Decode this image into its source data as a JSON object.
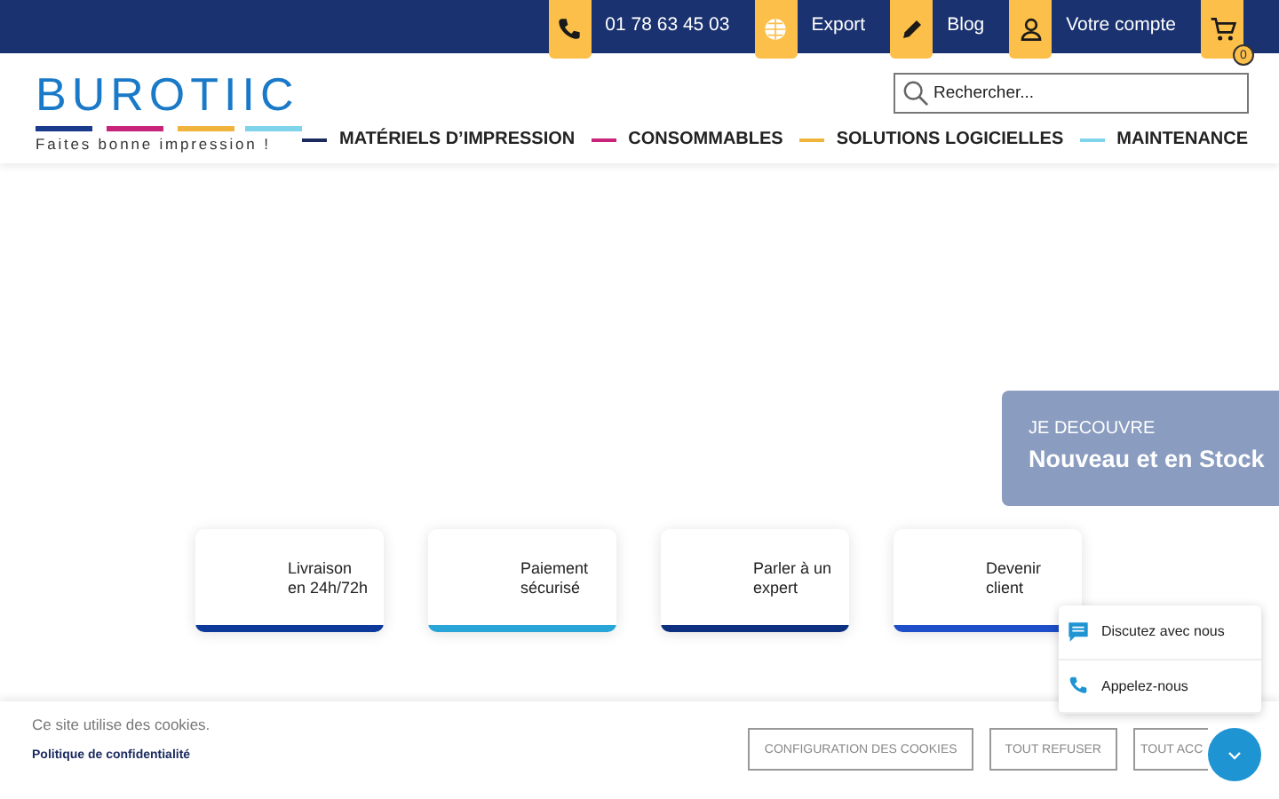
{
  "top_bar": {
    "items": [
      {
        "kind": "phone",
        "label": "01 78 63 45 03"
      },
      {
        "kind": "globe",
        "label": "Export"
      },
      {
        "kind": "pencil",
        "label": "Blog"
      },
      {
        "kind": "user",
        "label": "Votre compte"
      },
      {
        "kind": "cart",
        "badge": "0"
      }
    ]
  },
  "logo": {
    "name": "BUROTIIC",
    "tagline": "Faites bonne impression !"
  },
  "search": {
    "placeholder": "Rechercher..."
  },
  "nav": [
    {
      "label": "MATÉRIELS D’IMPRESSION",
      "color": "#1a2a5e"
    },
    {
      "label": "CONSOMMABLES",
      "color": "#c8237a"
    },
    {
      "label": "SOLUTIONS LOGICIELLES",
      "color": "#f0b43c"
    },
    {
      "label": "MAINTENANCE",
      "color": "#7fd3ea"
    }
  ],
  "promo": {
    "eyebrow": "JE DECOUVRE",
    "title": "Nouveau et en Stock"
  },
  "features": [
    {
      "label": "Livraison en 24h/72h",
      "color": "#0d3a9a"
    },
    {
      "label": "Paiement sécurisé",
      "color": "#2aa5d8"
    },
    {
      "label": "Parler à un expert",
      "color": "#0d3180"
    },
    {
      "label": "Devenir client",
      "color": "#1e4fc8"
    }
  ],
  "contact_menu": [
    {
      "kind": "chat",
      "label": "Discutez avec nous"
    },
    {
      "kind": "phone",
      "label": "Appelez-nous"
    }
  ],
  "cookie_bar": {
    "message": "Ce site utilise des cookies.",
    "link": "Politique de confidentialité",
    "buttons": [
      "CONFIGURATION DES COOKIES",
      "TOUT REFUSER",
      "TOUT ACC"
    ]
  }
}
